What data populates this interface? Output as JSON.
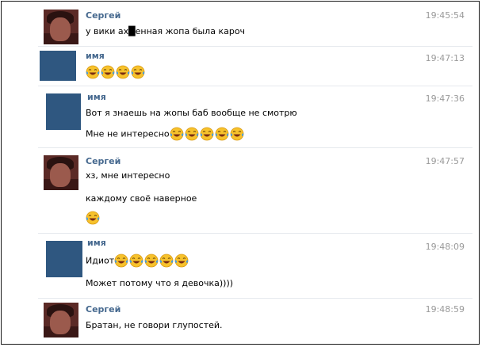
{
  "messages": [
    {
      "name": "Сергей",
      "time": "19:45:54",
      "lines": [
        {
          "text": "у вики ах█енная жопа была кароч",
          "emoji": 0
        }
      ],
      "avatar": "photo"
    },
    {
      "name": "имя",
      "time": "19:47:13",
      "lines": [
        {
          "text": "",
          "emoji": 4
        }
      ],
      "avatar": "blue"
    },
    {
      "name": "имя",
      "time": "19:47:36",
      "lines": [
        {
          "text": "Вот я знаешь на жопы баб вообще не смотрю",
          "emoji": 0
        },
        {
          "text": "Мне не интересно",
          "emoji": 5
        }
      ],
      "avatar": "blue"
    },
    {
      "name": "Сергей",
      "time": "19:47:57",
      "lines": [
        {
          "text": "хз, мне интересно",
          "emoji": 0
        },
        {
          "text": "каждому своё наверное",
          "emoji": 0
        },
        {
          "text": "",
          "emoji": 1
        }
      ],
      "avatar": "photo"
    },
    {
      "name": "имя",
      "time": "19:48:09",
      "lines": [
        {
          "text": "Идиот",
          "emoji": 5
        },
        {
          "text": "Может потому что я девочка))))",
          "emoji": 0
        }
      ],
      "avatar": "blue"
    },
    {
      "name": "Сергей",
      "time": "19:48:59",
      "lines": [
        {
          "text": "Братан, не говори глупостей.",
          "emoji": 0
        }
      ],
      "avatar": "photo"
    }
  ],
  "icons": {
    "emoji": "tears-of-joy-emoji-icon"
  },
  "colors": {
    "name": "#45688e",
    "time": "#9a9a9a",
    "avatar_blue": "#2f5780",
    "emoji_face": "#f7c22c",
    "emoji_tear": "#3e9bea"
  }
}
